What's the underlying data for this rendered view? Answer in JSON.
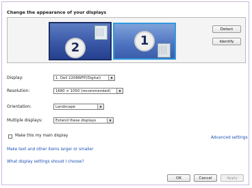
{
  "title": "Change the appearance of your displays",
  "monitors": [
    {
      "number": "2"
    },
    {
      "number": "1"
    }
  ],
  "buttons": {
    "detect": "Detect",
    "identify": "Identify",
    "ok": "OK",
    "cancel": "Cancel",
    "apply": "Apply"
  },
  "fields": {
    "display": {
      "label": "Display:",
      "value": "1. Dell 2208WFP(Digital)"
    },
    "resolution": {
      "label": "Resolution:",
      "value": "1680 × 1050 (recommended)"
    },
    "orientation": {
      "label": "Orientation:",
      "value": "Landscape"
    },
    "multiple": {
      "label": "Multiple displays:",
      "value": "Extend these displays"
    }
  },
  "checkbox": {
    "label": "Make this my main display",
    "checked": false
  },
  "links": {
    "advanced": "Advanced settings",
    "text_size": "Make text and other items larger or smaller",
    "which": "What display settings should I choose?"
  }
}
